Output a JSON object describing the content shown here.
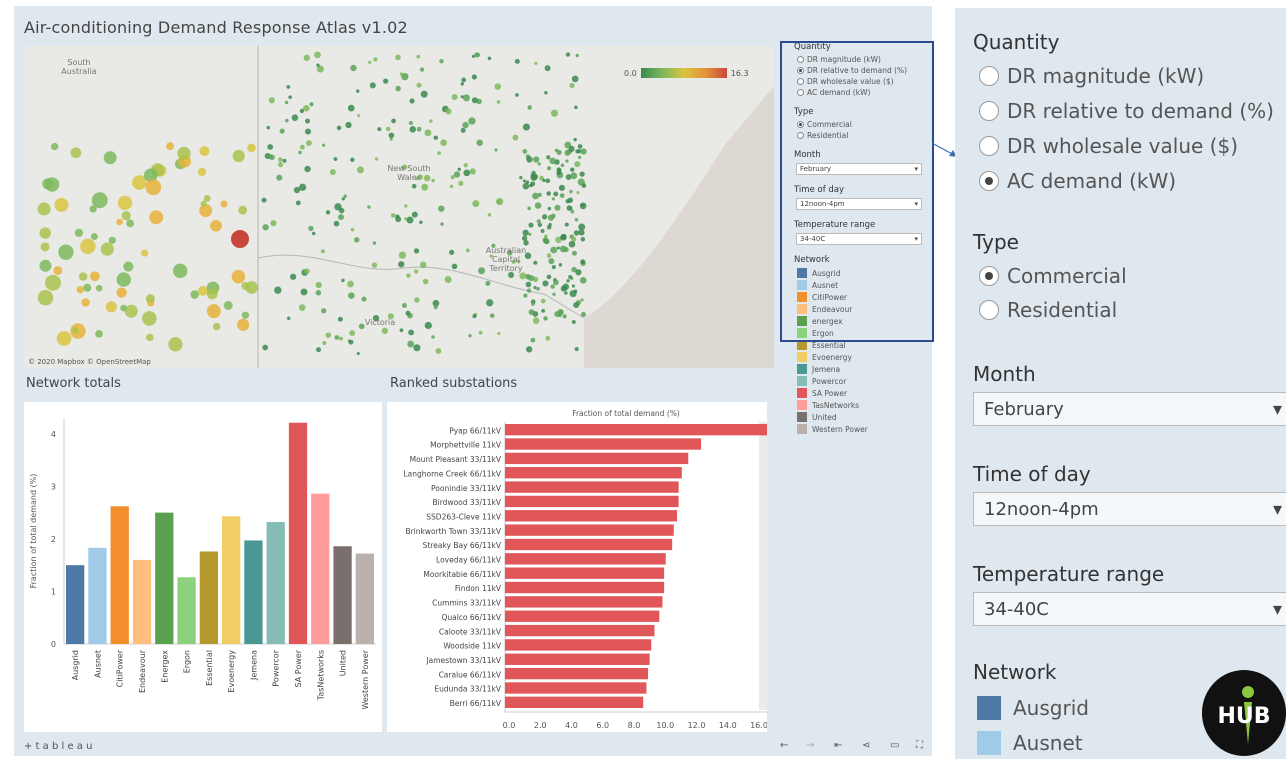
{
  "app": {
    "title": "Air-conditioning Demand Response Atlas v1.02",
    "footer_brand": "+ t a b l e a u"
  },
  "map": {
    "labels": [
      "South Australia",
      "New South Wales",
      "Australian Capital Territory",
      "Victoria"
    ],
    "credit": "© 2020 Mapbox © OpenStreetMap",
    "scale_min": "0.0",
    "scale_max": "16.3"
  },
  "filters": {
    "quantity_label": "Quantity",
    "quantity_options": [
      "DR magnitude (kW)",
      "DR relative to demand (%)",
      "DR wholesale value ($)",
      "AC demand (kW)"
    ],
    "quantity_selected_small": 1,
    "quantity_selected_large": 3,
    "type_label": "Type",
    "type_options": [
      "Commercial",
      "Residential"
    ],
    "type_selected": 0,
    "month_label": "Month",
    "month_value": "February",
    "time_label": "Time of day",
    "time_value": "12noon-4pm",
    "temp_label": "Temperature range",
    "temp_value": "34-40C",
    "network_label": "Network",
    "dropdown_icon": "▾"
  },
  "networks": [
    {
      "name": "Ausgrid",
      "color": "#4e79a7"
    },
    {
      "name": "Ausnet",
      "color": "#a0cbe8"
    },
    {
      "name": "CitiPower",
      "color": "#f28e2b"
    },
    {
      "name": "Endeavour",
      "color": "#ffbe7d"
    },
    {
      "name": "energex",
      "color": "#59a14f"
    },
    {
      "name": "Ergon",
      "color": "#8cd17d"
    },
    {
      "name": "Essential",
      "color": "#b6992d"
    },
    {
      "name": "Evoenergy",
      "color": "#f1ce63"
    },
    {
      "name": "Jemena",
      "color": "#499894"
    },
    {
      "name": "Powercor",
      "color": "#86bcb6"
    },
    {
      "name": "SA Power",
      "color": "#e15759"
    },
    {
      "name": "TasNetworks",
      "color": "#ff9d9a"
    },
    {
      "name": "United",
      "color": "#79706e"
    },
    {
      "name": "Western Power",
      "color": "#bab0ac"
    }
  ],
  "sections": {
    "network_totals": "Network totals",
    "ranked_substations": "Ranked substations"
  },
  "chart_data": [
    {
      "type": "bar",
      "title": "Network totals",
      "ylabel": "Fraction of total demand (%)",
      "ylim": [
        0,
        4.3
      ],
      "yticks": [
        0,
        1,
        2,
        3,
        4
      ],
      "categories": [
        "Ausgrid",
        "Ausnet",
        "CitiPower",
        "Endeavour",
        "Energex",
        "Ergon",
        "Essential",
        "Evoenergy",
        "Jemena",
        "Powercor",
        "SA Power",
        "TasNetworks",
        "United",
        "Western Power"
      ],
      "values": [
        1.5,
        1.83,
        2.62,
        1.6,
        2.5,
        1.27,
        1.76,
        2.43,
        1.97,
        2.32,
        4.21,
        2.86,
        1.86,
        1.72
      ],
      "colors": [
        "#4e79a7",
        "#a0cbe8",
        "#f28e2b",
        "#ffbe7d",
        "#59a14f",
        "#8cd17d",
        "#b6992d",
        "#f1ce63",
        "#499894",
        "#86bcb6",
        "#e15759",
        "#ff9d9a",
        "#79706e",
        "#bab0ac"
      ]
    },
    {
      "type": "bar",
      "orientation": "horizontal",
      "title": "Ranked substations",
      "xlabel": "Fraction of total demand (%)",
      "xlim": [
        0,
        16.3
      ],
      "xticks": [
        "0.0",
        "2.0",
        "4.0",
        "6.0",
        "8.0",
        "10.0",
        "12.0",
        "14.0",
        "16.0"
      ],
      "categories": [
        "Pyap 66/11kV",
        "Morphettville 11kV",
        "Mount Pleasant 33/11kV",
        "Langhorne Creek 66/11kV",
        "Poonindie 33/11kV",
        "Birdwood 33/11kV",
        "SSD263-Cleve 11kV",
        "Brinkworth Town 33/11kV",
        "Streaky Bay 66/11kV",
        "Loveday 66/11kV",
        "Moorkitabie 66/11kV",
        "Findon 11kV",
        "Cummins 33/11kV",
        "Qualco 66/11kV",
        "Caloote 33/11kV",
        "Woodside 11kV",
        "Jamestown 33/11kV",
        "Caralue 66/11kV",
        "Eudunda 33/11kV",
        "Berri 66/11kV"
      ],
      "values": [
        16.3,
        12.2,
        11.4,
        11.0,
        10.8,
        10.8,
        10.7,
        10.5,
        10.4,
        10.0,
        9.9,
        9.9,
        9.8,
        9.6,
        9.3,
        9.1,
        9.0,
        8.9,
        8.8,
        8.6
      ],
      "color": "#e15759"
    }
  ]
}
